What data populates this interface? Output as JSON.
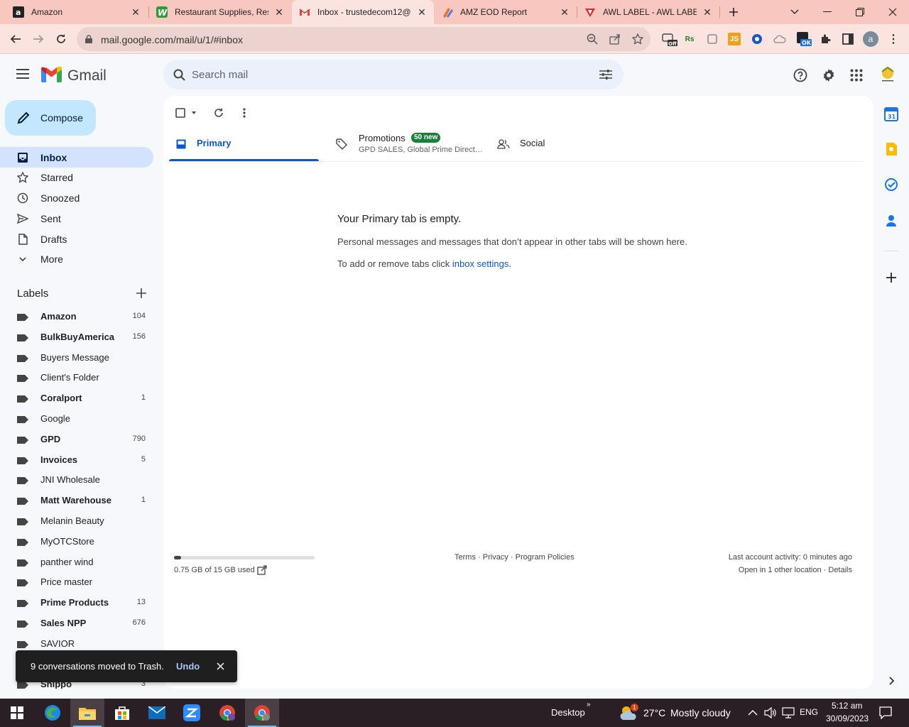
{
  "browser": {
    "tabs": [
      {
        "title": "Amazon",
        "icon": "amazon-icon",
        "active": false
      },
      {
        "title": "Restaurant Supplies, Rest",
        "icon": "webstaurant-icon",
        "active": false
      },
      {
        "title": "Inbox - trustedecom12@",
        "icon": "gmail-icon",
        "active": true
      },
      {
        "title": "AMZ EOD Report",
        "icon": "zoho-icon",
        "active": false
      },
      {
        "title": "AWL LABEL - AWL LABEL",
        "icon": "awl-icon",
        "active": false
      }
    ],
    "url": "mail.google.com/mail/u/1/#inbox",
    "profile_initial": "a",
    "ext_off_label": "Off",
    "ext_ok_label": "OK",
    "ext_rs_label": "Rs",
    "ext_js_label": "JS"
  },
  "gmail": {
    "logo_text": "Gmail",
    "search_placeholder": "Search mail",
    "compose_label": "Compose",
    "nav": [
      {
        "label": "Inbox",
        "icon": "inbox-icon",
        "active": true
      },
      {
        "label": "Starred",
        "icon": "star-icon"
      },
      {
        "label": "Snoozed",
        "icon": "clock-icon"
      },
      {
        "label": "Sent",
        "icon": "send-icon"
      },
      {
        "label": "Drafts",
        "icon": "draft-icon"
      },
      {
        "label": "More",
        "icon": "chevron-down-icon"
      }
    ],
    "labels_heading": "Labels",
    "labels": [
      {
        "name": "Amazon",
        "count": "104",
        "unread": true
      },
      {
        "name": "BulkBuyAmerica",
        "count": "156",
        "unread": true
      },
      {
        "name": "Buyers Message",
        "count": "",
        "unread": false
      },
      {
        "name": "Client's Folder",
        "count": "",
        "unread": false
      },
      {
        "name": "Coralport",
        "count": "1",
        "unread": true
      },
      {
        "name": "Google",
        "count": "",
        "unread": false
      },
      {
        "name": "GPD",
        "count": "790",
        "unread": true
      },
      {
        "name": "Invoices",
        "count": "5",
        "unread": true
      },
      {
        "name": "JNI Wholesale",
        "count": "",
        "unread": false
      },
      {
        "name": "Matt Warehouse",
        "count": "1",
        "unread": true
      },
      {
        "name": "Melanin Beauty",
        "count": "",
        "unread": false
      },
      {
        "name": "MyOTCStore",
        "count": "",
        "unread": false
      },
      {
        "name": "panther wind",
        "count": "",
        "unread": false
      },
      {
        "name": "Price master",
        "count": "",
        "unread": false
      },
      {
        "name": "Prime Products",
        "count": "13",
        "unread": true
      },
      {
        "name": "Sales NPP",
        "count": "676",
        "unread": true
      },
      {
        "name": "SAVIOR",
        "count": "",
        "unread": false
      },
      {
        "name": "",
        "count": "",
        "unread": false
      },
      {
        "name": "Shippo",
        "count": "3",
        "unread": true
      }
    ],
    "category_tabs": {
      "primary": "Primary",
      "promotions": "Promotions",
      "promotions_badge": "50 new",
      "promotions_senders": "GPD SALES, Global Prime Direct…",
      "social": "Social"
    },
    "empty_state": {
      "title": "Your Primary tab is empty.",
      "body": "Personal messages and messages that don’t appear in other tabs will be shown here.",
      "settings_prefix": "To add or remove tabs click ",
      "settings_link": "inbox settings",
      "settings_suffix": "."
    },
    "footer": {
      "storage_fraction": 0.05,
      "storage_text": "0.75 GB of 15 GB used",
      "terms": "Terms",
      "privacy": "Privacy",
      "policies": "Program Policies",
      "sep": "·",
      "last_activity": "Last account activity: 0 minutes ago",
      "open_location": "Open in 1 other location",
      "details": "Details"
    },
    "snackbar": {
      "message": "9 conversations moved to Trash.",
      "undo": "Undo"
    },
    "calendar_day": "31"
  },
  "taskbar": {
    "desktop_label": "Desktop",
    "weather_temp": "27°C",
    "weather_desc": "Mostly cloudy",
    "weather_badge": "1",
    "language": "ENG",
    "time": "5:12 am",
    "date": "30/09/2023"
  },
  "colors": {
    "accent": "#0b57d0",
    "compose_bg": "#c2e7ff",
    "active_nav_bg": "#d3e3fd",
    "badge_green": "#188038",
    "tab_strip": "#f8c7c0"
  }
}
